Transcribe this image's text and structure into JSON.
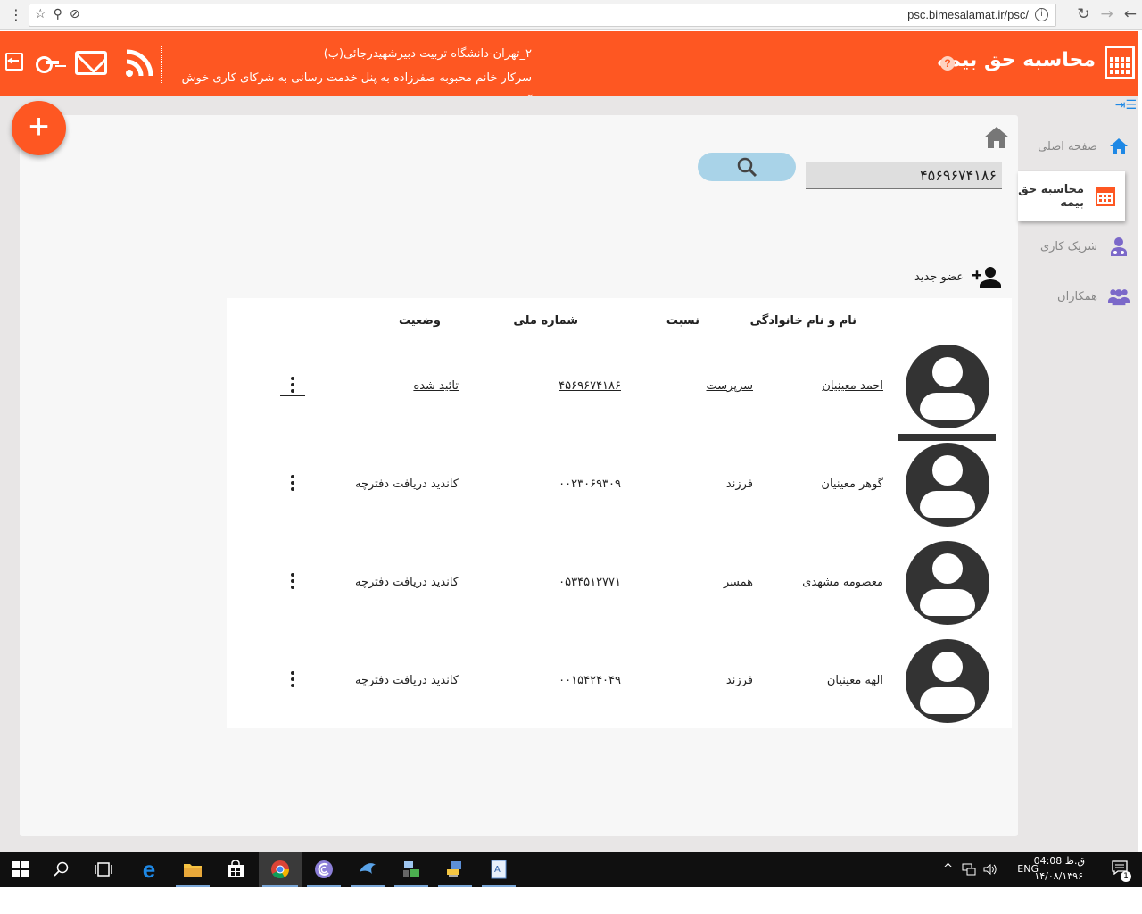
{
  "browser": {
    "url": "psc.bimesalamat.ir/psc/"
  },
  "header": {
    "app_title": "محاسبه حق بیمه",
    "welcome_line1": "۲_تهران-دانشگاه تربیت دبیرشهیدرجائی(ب)",
    "welcome_line2": "سرکار خانم محبوبه صفرزاده به پنل خدمت رسانی به شرکای کاری خوش آمدید.",
    "accent_color": "#fe5722"
  },
  "sidebar": {
    "items": [
      {
        "label": "صفحه اصلی",
        "icon": "home-icon",
        "active": false
      },
      {
        "label": "محاسبه حق بیمه",
        "icon": "calculator-icon",
        "active": true
      },
      {
        "label": "شریک کاری",
        "icon": "partner-icon",
        "active": false
      },
      {
        "label": "همکاران",
        "icon": "colleagues-icon",
        "active": false
      }
    ]
  },
  "search": {
    "value": "۴۵۶۹۶۷۴۱۸۶"
  },
  "new_member_label": "عضو جدید",
  "table": {
    "headers": {
      "name": "نام و نام خانوادگی",
      "relation": "نسبت",
      "national_id": "شماره ملی",
      "status": "وضعیت"
    },
    "rows": [
      {
        "name": "احمد معینیان",
        "relation": "سرپرست",
        "national_id": "۴۵۶۹۶۷۴۱۸۶",
        "status": "تائید شده"
      },
      {
        "name": "گوهر معینیان",
        "relation": "فرزند",
        "national_id": "۰۰۲۳۰۶۹۳۰۹",
        "status": "کاندید دریافت دفترچه"
      },
      {
        "name": "معصومه مشهدی",
        "relation": "همسر",
        "national_id": "۰۵۳۴۵۱۲۷۷۱",
        "status": "کاندید دریافت دفترچه"
      },
      {
        "name": "الهه معینیان",
        "relation": "فرزند",
        "national_id": "۰۰۱۵۴۲۴۰۴۹",
        "status": "کاندید دریافت دفترچه"
      }
    ]
  },
  "taskbar": {
    "lang": "ENG",
    "time": "ق.ظ 04:08",
    "date": "۱۴/۰۸/۱۳۹۶",
    "notification_count": "1"
  }
}
